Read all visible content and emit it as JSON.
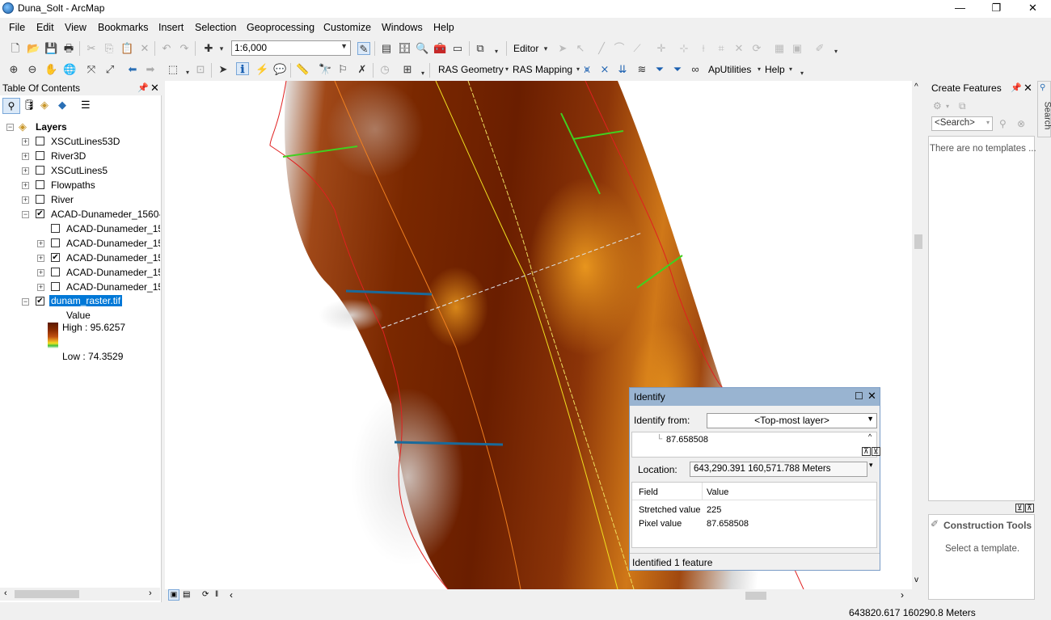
{
  "window": {
    "title": "Duna_Solt - ArcMap",
    "minimize": "—",
    "maximize": "❐",
    "close": "✕"
  },
  "menu": [
    "File",
    "Edit",
    "View",
    "Bookmarks",
    "Insert",
    "Selection",
    "Geoprocessing",
    "Customize",
    "Windows",
    "Help"
  ],
  "toolbar": {
    "scale": "1:6,000",
    "editor_label": "Editor",
    "ras_geometry": "RAS Geometry",
    "ras_mapping": "RAS Mapping",
    "aputilities": "ApUtilities",
    "help": "Help"
  },
  "toc": {
    "title": "Table Of Contents",
    "root": "Layers",
    "layers": [
      {
        "name": "XSCutLines53D",
        "checked": false
      },
      {
        "name": "River3D",
        "checked": false
      },
      {
        "name": "XSCutLines5",
        "checked": false
      },
      {
        "name": "Flowpaths",
        "checked": false
      },
      {
        "name": "River",
        "checked": false
      },
      {
        "name": "ACAD-Dunameder_1560-",
        "checked": true
      }
    ],
    "sublayers": [
      {
        "name": "ACAD-Dunameder_15",
        "checked": false
      },
      {
        "name": "ACAD-Dunameder_15",
        "checked": false
      },
      {
        "name": "ACAD-Dunameder_15",
        "checked": true
      },
      {
        "name": "ACAD-Dunameder_15",
        "checked": false
      },
      {
        "name": "ACAD-Dunameder_15",
        "checked": false
      }
    ],
    "raster": {
      "name": "dunam_raster.tif",
      "checked": true,
      "value_label": "Value",
      "high": "High : 95.6257",
      "low": "Low : 74.3529"
    }
  },
  "identify": {
    "title": "Identify",
    "from_label": "Identify from:",
    "from_value": "<Top-most layer>",
    "tree_value": "87.658508",
    "location_label": "Location:",
    "location_value": "643,290.391  160,571.788 Meters",
    "col_field": "Field",
    "col_value": "Value",
    "rows": [
      {
        "field": "Stretched value",
        "value": "225"
      },
      {
        "field": "Pixel value",
        "value": "87.658508"
      }
    ],
    "status": "Identified 1 feature"
  },
  "create_features": {
    "title": "Create Features",
    "search_placeholder": "<Search>",
    "empty_msg": "There are no templates ...",
    "construction_title": "Construction Tools",
    "construction_msg": "Select a template."
  },
  "search_tab": "Search",
  "status": {
    "coords": "643820.617  160290.8 Meters"
  }
}
